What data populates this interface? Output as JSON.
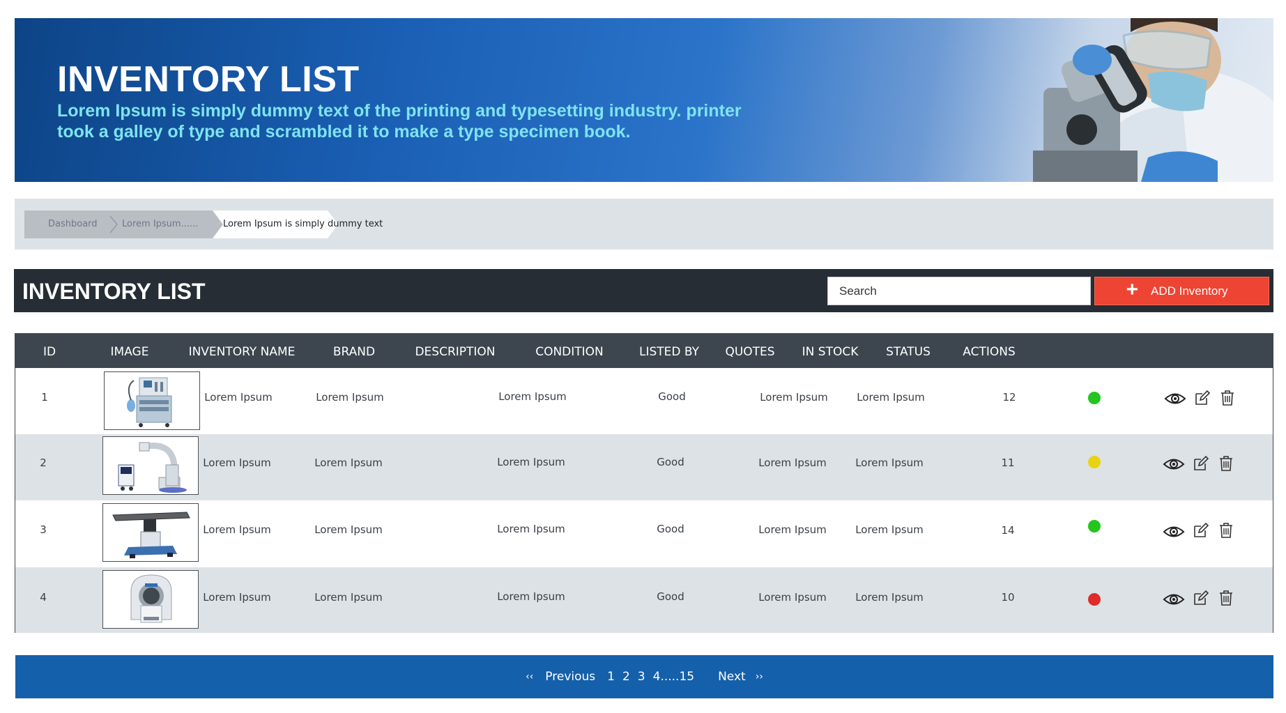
{
  "banner": {
    "title": "INVENTORY LIST",
    "subtitle_line1": "Lorem Ipsum is simply dummy text of the printing and typesetting industry. printer",
    "subtitle_line2": "took a galley of type and scrambled it to make a type specimen book."
  },
  "breadcrumb": [
    "Dashboard",
    "Lorem Ipsum......",
    "Lorem Ipsum is simply dummy text"
  ],
  "toolbar": {
    "title": "INVENTORY LIST",
    "search_placeholder": "Search",
    "add_icon": "+",
    "add_label": "ADD Inventory"
  },
  "table": {
    "headers": [
      "ID",
      "IMAGE",
      "INVENTORY NAME",
      "BRAND",
      "DESCRIPTION",
      "CONDITION",
      "LISTED BY",
      "QUOTES",
      "IN STOCK",
      "STATUS",
      "ACTIONS"
    ],
    "rows": [
      {
        "id": "1",
        "image": "anesthesia-machine",
        "name": "Lorem Ipsum",
        "brand": "Lorem Ipsum",
        "description": "Lorem Ipsum",
        "condition": "Good",
        "listed_by": "Lorem Ipsum",
        "quotes": "Lorem Ipsum",
        "in_stock": "12",
        "status": "green"
      },
      {
        "id": "2",
        "image": "c-arm-xray",
        "name": "Lorem Ipsum",
        "brand": "Lorem Ipsum",
        "description": "Lorem Ipsum",
        "condition": "Good",
        "listed_by": "Lorem Ipsum",
        "quotes": "Lorem Ipsum",
        "in_stock": "11",
        "status": "yellow"
      },
      {
        "id": "3",
        "image": "surgical-table",
        "name": "Lorem Ipsum",
        "brand": "Lorem Ipsum",
        "description": "Lorem Ipsum",
        "condition": "Good",
        "listed_by": "Lorem Ipsum",
        "quotes": "Lorem Ipsum",
        "in_stock": "14",
        "status": "green"
      },
      {
        "id": "4",
        "image": "mri-scanner",
        "name": "Lorem Ipsum",
        "brand": "Lorem Ipsum",
        "description": "Lorem Ipsum",
        "condition": "Good",
        "listed_by": "Lorem Ipsum",
        "quotes": "Lorem Ipsum",
        "in_stock": "10",
        "status": "red"
      }
    ],
    "actions": [
      "view-icon",
      "edit-icon",
      "delete-icon"
    ]
  },
  "status_colors": {
    "green": "#22c61d",
    "yellow": "#e8d311",
    "red": "#e02b2b"
  },
  "colors": {
    "header_dark": "#262d34",
    "table_head": "#3d464e",
    "accent_red": "#ee4433",
    "pager_blue": "#1560aa"
  },
  "pagination": {
    "prev_chevron": "‹‹",
    "previous": "Previous",
    "pages": [
      "1",
      "2",
      "3",
      "4.....15"
    ],
    "next": "Next",
    "next_chevron": "››"
  }
}
